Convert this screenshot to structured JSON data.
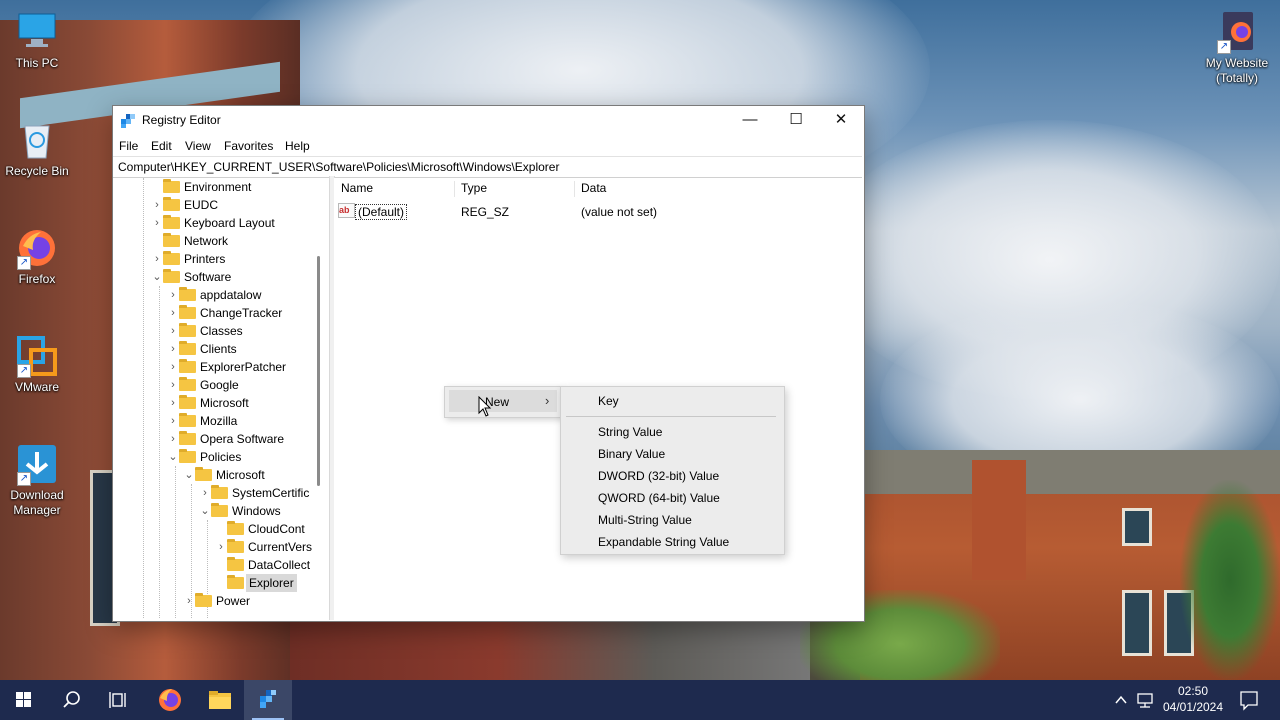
{
  "desktop": {
    "icons": [
      {
        "label": "This PC"
      },
      {
        "label": "Recycle Bin"
      },
      {
        "label": "Firefox"
      },
      {
        "label": "VMware"
      },
      {
        "label": "Download Manager"
      },
      {
        "label": "My Website (Totally)"
      }
    ]
  },
  "window": {
    "title": "Registry Editor",
    "controls": {
      "minimize": "—",
      "maximize": "☐",
      "close": "✕"
    },
    "menu": [
      "File",
      "Edit",
      "View",
      "Favorites",
      "Help"
    ],
    "address": "Computer\\HKEY_CURRENT_USER\\Software\\Policies\\Microsoft\\Windows\\Explorer",
    "tree": [
      {
        "label": "Environment",
        "expander": ""
      },
      {
        "label": "EUDC",
        "expander": "›"
      },
      {
        "label": "Keyboard Layout",
        "expander": "›"
      },
      {
        "label": "Network",
        "expander": ""
      },
      {
        "label": "Printers",
        "expander": "›"
      },
      {
        "label": "Software",
        "expander": "⌄"
      },
      {
        "label": "appdatalow",
        "expander": "›"
      },
      {
        "label": "ChangeTracker",
        "expander": "›"
      },
      {
        "label": "Classes",
        "expander": "›"
      },
      {
        "label": "Clients",
        "expander": "›"
      },
      {
        "label": "ExplorerPatcher",
        "expander": "›"
      },
      {
        "label": "Google",
        "expander": "›"
      },
      {
        "label": "Microsoft",
        "expander": "›"
      },
      {
        "label": "Mozilla",
        "expander": "›"
      },
      {
        "label": "Opera Software",
        "expander": "›"
      },
      {
        "label": "Policies",
        "expander": "⌄"
      },
      {
        "label": "Microsoft",
        "expander": "⌄"
      },
      {
        "label": "SystemCertific",
        "expander": "›"
      },
      {
        "label": "Windows",
        "expander": "⌄"
      },
      {
        "label": "CloudCont",
        "expander": ""
      },
      {
        "label": "CurrentVers",
        "expander": "›"
      },
      {
        "label": "DataCollect",
        "expander": ""
      },
      {
        "label": "Explorer",
        "expander": "",
        "selected": true
      },
      {
        "label": "Power",
        "expander": "›"
      }
    ],
    "columns": {
      "name": "Name",
      "type": "Type",
      "data": "Data"
    },
    "values": [
      {
        "icon": "ab",
        "name": "(Default)",
        "type": "REG_SZ",
        "data": "(value not set)"
      }
    ]
  },
  "context_menu": {
    "new_label": "New",
    "new_arrow": "›",
    "submenu": {
      "first": "Key",
      "items": [
        "String Value",
        "Binary Value",
        "DWORD (32-bit) Value",
        "QWORD (64-bit) Value",
        "Multi-String Value",
        "Expandable String Value"
      ]
    }
  },
  "taskbar": {
    "time": "02:50",
    "date": "04/01/2024",
    "tray_chevron": "^"
  },
  "colors": {
    "taskbar": "#1e2a4e",
    "folder": "#f5c542",
    "menu_bg": "#ececec",
    "highlight": "#dcdcdc"
  }
}
